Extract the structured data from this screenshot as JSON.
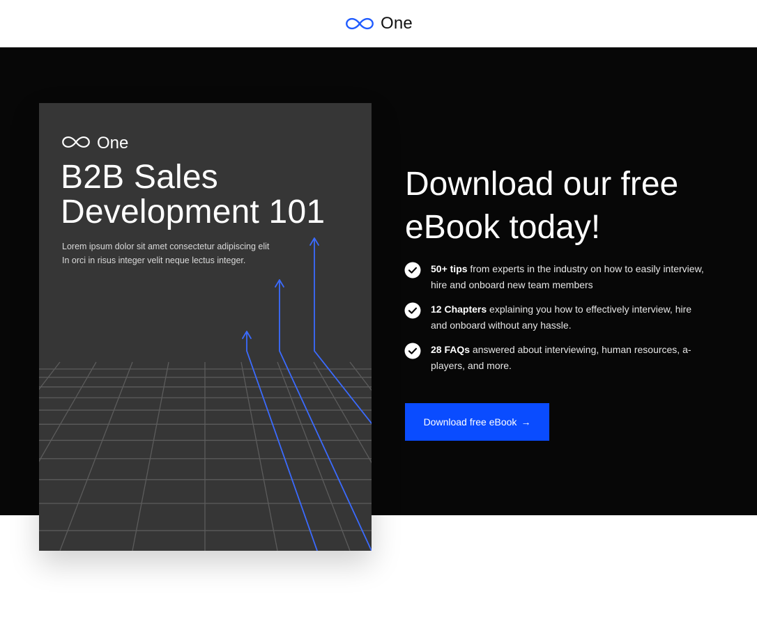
{
  "header": {
    "brand_name": "One",
    "brand_icon": "infinity-logo-icon",
    "accent": "#1f5bff"
  },
  "cover": {
    "brand_name": "One",
    "title_lines": [
      "B2B Sales",
      "Development 101"
    ],
    "subtitle_lines": [
      "Lorem ipsum dolor sit amet consectetur adipiscing elit",
      "In orci in risus integer velit neque lectus integer."
    ],
    "background": "#363636",
    "line_color": "#3b6bff"
  },
  "hero": {
    "headline_lines": [
      "Download our free",
      "eBook today!"
    ],
    "features": [
      {
        "bold": "50+ tips",
        "text": " from experts in the industry on how to easily interview, hire and onboard new team members"
      },
      {
        "bold": "12 Chapters",
        "text": " explaining you how to effectively interview, hire and onboard without any hassle."
      },
      {
        "bold": "28 FAQs",
        "text": " answered about interviewing, human resources, a-players, and more."
      }
    ],
    "cta_label": "Download free eBook",
    "cta_arrow": "→",
    "cta_color": "#0a4cff"
  }
}
